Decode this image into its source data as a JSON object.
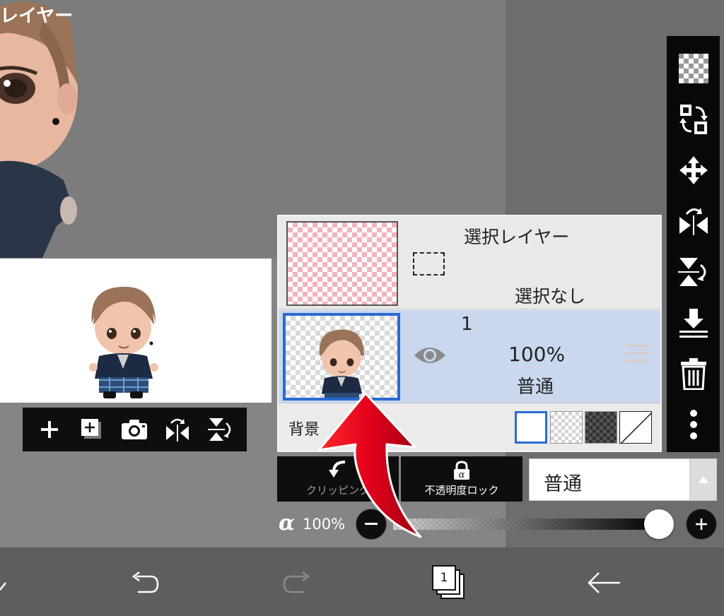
{
  "header": {
    "title": "レイヤー"
  },
  "colors": {
    "accent": "#2a6ad3",
    "selected_row": "#c9d8ee",
    "toolbar_bg": "#080808",
    "arrow": "#e3001b"
  },
  "preview_toolbar": {
    "buttons": [
      {
        "icon": "plus-icon"
      },
      {
        "icon": "add-layer-icon"
      },
      {
        "icon": "camera-icon"
      },
      {
        "icon": "flip-horizontal-icon"
      },
      {
        "icon": "flip-vertical-icon"
      }
    ]
  },
  "side_toolbar": {
    "buttons": [
      {
        "icon": "transparency-checker-icon"
      },
      {
        "icon": "swap-layers-icon"
      },
      {
        "icon": "move-icon"
      },
      {
        "icon": "flip-horizontal-icon"
      },
      {
        "icon": "flip-vertical-icon"
      },
      {
        "icon": "merge-down-icon"
      },
      {
        "icon": "trash-icon"
      },
      {
        "icon": "more-vertical-icon"
      }
    ]
  },
  "layers": {
    "selection_layer": {
      "title": "選択レイヤー",
      "status": "選択なし"
    },
    "items": [
      {
        "name": "1",
        "opacity": "100%",
        "blend_mode": "普通",
        "visible": true,
        "selected": true
      }
    ],
    "background": {
      "label": "背景",
      "options": [
        "white",
        "checker-light",
        "checker-dark",
        "none"
      ],
      "selected": "white"
    }
  },
  "controls": {
    "clipping_label": "クリッピング",
    "opacity_lock_label": "不透明度ロック",
    "blend_mode": "普通",
    "alpha_symbol": "α",
    "alpha_value": "100%",
    "alpha_level": 1.0,
    "alpha_minus": "−",
    "alpha_plus": "+"
  },
  "bottom_bar": {
    "undo_icon": "undo-icon",
    "redo_icon": "redo-icon",
    "layer_count": "1",
    "back_icon": "back-arrow-icon"
  }
}
